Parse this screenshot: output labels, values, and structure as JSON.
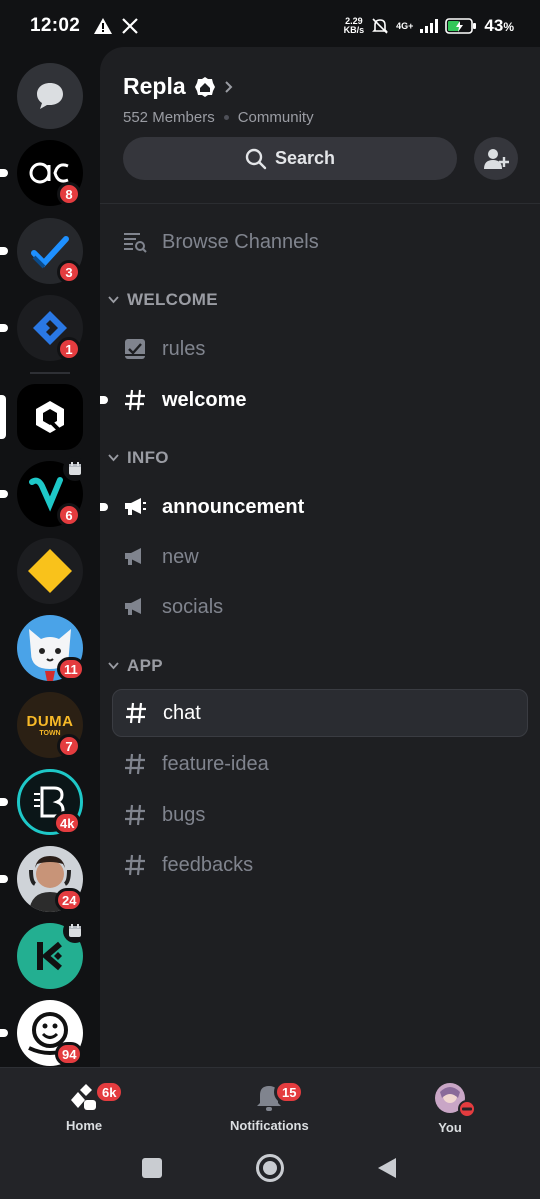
{
  "status_bar": {
    "time": "12:02",
    "net_speed_value": "2.29",
    "net_speed_unit": "KB/s",
    "network": "4G+",
    "battery": "43",
    "battery_unit": "%"
  },
  "rail": {
    "items": [
      {
        "name": "direct-messages",
        "badge": null
      },
      {
        "name": "server-ac",
        "badge": "8"
      },
      {
        "name": "server-checkmark",
        "badge": "3"
      },
      {
        "name": "server-blue-diamond",
        "badge": "1"
      },
      {
        "name": "server-repla",
        "badge": null
      },
      {
        "name": "server-v",
        "badge": "6"
      },
      {
        "name": "server-yellow-diamond",
        "badge": null
      },
      {
        "name": "server-cat",
        "badge": "11"
      },
      {
        "name": "server-duma-town",
        "badge": "7",
        "text": "DUMA",
        "subtext": "TOWN"
      },
      {
        "name": "server-b",
        "badge": "4k"
      },
      {
        "name": "server-person",
        "badge": "24"
      },
      {
        "name": "server-k",
        "badge": null
      },
      {
        "name": "server-smiley",
        "badge": "94"
      }
    ]
  },
  "server": {
    "name": "Repla",
    "members": "552 Members",
    "type": "Community",
    "search_label": "Search"
  },
  "channels": {
    "browse_label": "Browse Channels",
    "categories": [
      {
        "label": "WELCOME",
        "items": [
          {
            "label": "rules"
          },
          {
            "label": "welcome"
          }
        ]
      },
      {
        "label": "INFO",
        "items": [
          {
            "label": "announcement"
          },
          {
            "label": "new"
          },
          {
            "label": "socials"
          }
        ]
      },
      {
        "label": "APP",
        "items": [
          {
            "label": "chat"
          },
          {
            "label": "feature-idea"
          },
          {
            "label": "bugs"
          },
          {
            "label": "feedbacks"
          }
        ]
      }
    ]
  },
  "bottom_nav": {
    "home_label": "Home",
    "home_badge": "6k",
    "notifications_label": "Notifications",
    "notifications_badge": "15",
    "you_label": "You"
  },
  "colors": {
    "background": "#111214",
    "panel": "#1e1f22",
    "badge": "#e43c3f",
    "muted_text": "#80848e"
  }
}
